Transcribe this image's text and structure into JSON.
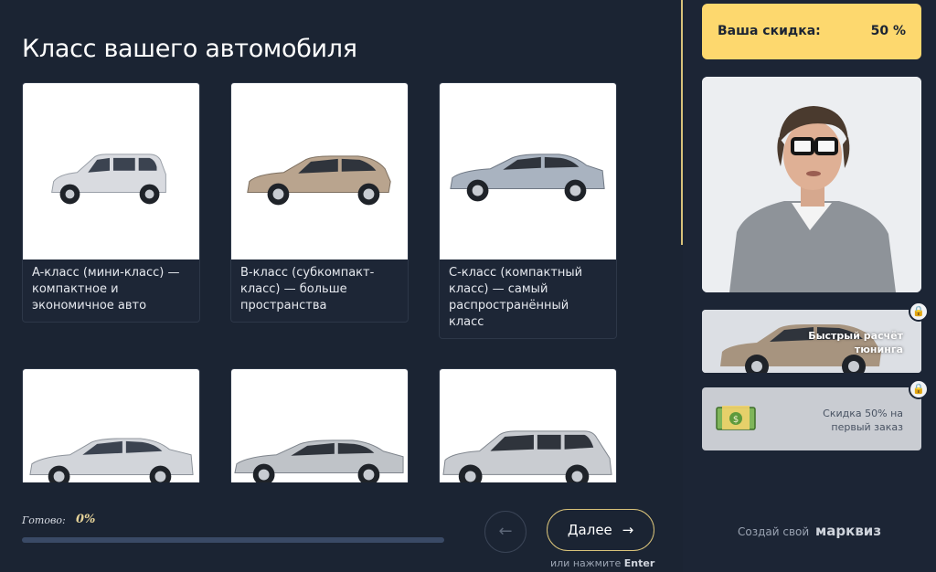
{
  "page": {
    "title": "Класс вашего автомобиля"
  },
  "cards": [
    {
      "label": "A-класс (мини-класс) — компактное и экономичное авто",
      "car_color": "#d9dbe0"
    },
    {
      "label": "B-класс (субкомпакт-класс) — больше пространства",
      "car_color": "#b9a48e"
    },
    {
      "label": "C-класс (компактный класс) — самый распространённый класс",
      "car_color": "#a9b3c0"
    },
    {
      "label": "",
      "car_color": "#d2d5da"
    },
    {
      "label": "",
      "car_color": "#bfc3c8"
    },
    {
      "label": "",
      "car_color": "#c9ccd1"
    }
  ],
  "progress": {
    "label": "Готово:",
    "value_text": "0%",
    "value": 0
  },
  "navigation": {
    "back_icon": "arrow-left-icon",
    "next_label": "Далее",
    "next_icon": "arrow-right-icon",
    "hint_prefix": "или нажмите",
    "hint_key": "Enter"
  },
  "sidebar": {
    "discount_label": "Ваша скидка:",
    "discount_value": "50 %",
    "bonus1_text_line1": "Быстрый расчёт",
    "bonus1_text_line2": "тюнинга",
    "bonus2_text_line1": "Скидка 50% на",
    "bonus2_text_line2": "первый заказ",
    "footer_prefix": "Создай свой",
    "footer_brand": "марквиз"
  },
  "colors": {
    "background": "#1b2433",
    "accent_yellow": "#fdd86e",
    "accent_gold": "#d8c27a"
  }
}
